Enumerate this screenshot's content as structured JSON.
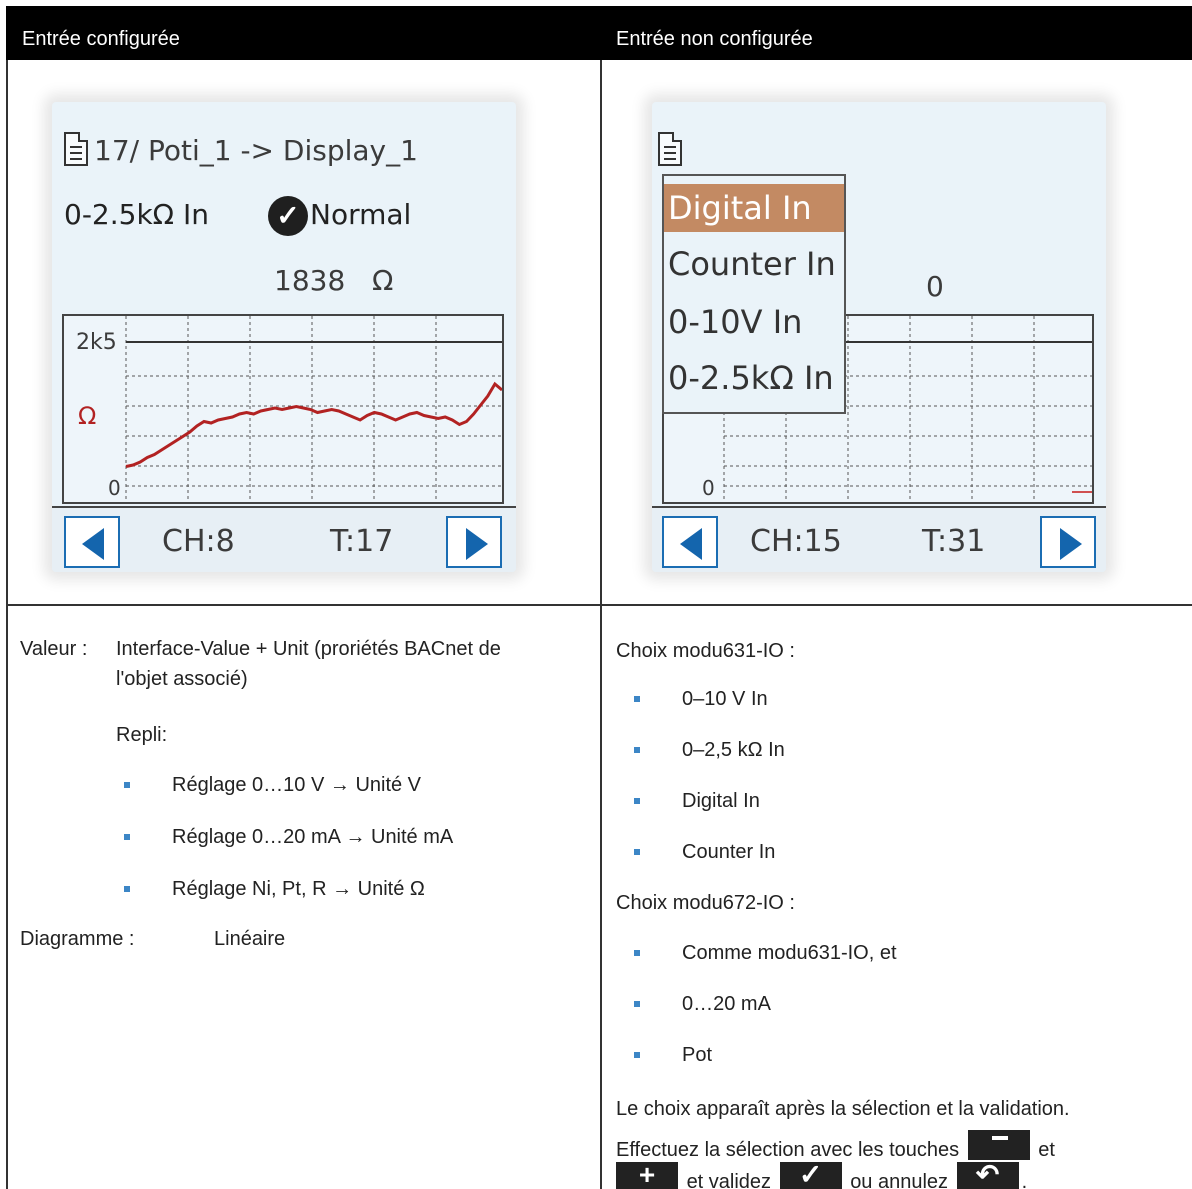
{
  "header": {
    "left": "Entrée configurée",
    "right": "Entrée non configurée"
  },
  "screen1": {
    "title": "17/ Poti_1 -> Display_1",
    "mode": "0-2.5kΩ In",
    "status": "Normal",
    "value": "1838",
    "unit": "Ω",
    "y_top_label": "2k5",
    "y_unit_label": "Ω",
    "y_zero_label": "0",
    "ch": "CH:8",
    "t": "T:17",
    "trace_color": "#b22222",
    "trace": [
      0.17,
      0.18,
      0.2,
      0.23,
      0.25,
      0.28,
      0.31,
      0.34,
      0.37,
      0.4,
      0.44,
      0.47,
      0.46,
      0.48,
      0.49,
      0.5,
      0.52,
      0.53,
      0.52,
      0.54,
      0.55,
      0.56,
      0.55,
      0.56,
      0.57,
      0.56,
      0.55,
      0.53,
      0.54,
      0.55,
      0.54,
      0.52,
      0.5,
      0.48,
      0.51,
      0.53,
      0.52,
      0.5,
      0.48,
      0.5,
      0.52,
      0.53,
      0.51,
      0.5,
      0.49,
      0.5,
      0.48,
      0.45,
      0.47,
      0.52,
      0.58,
      0.64,
      0.72,
      0.68
    ]
  },
  "screen2": {
    "menu": [
      "Digital In",
      "Counter In",
      "0-10V In",
      "0-2.5kΩ In"
    ],
    "value": "0",
    "y_zero_label": "0",
    "ch": "CH:15",
    "t": "T:31",
    "accent": "#c38a63"
  },
  "left_text": {
    "valeur_label": "Valeur :",
    "valeur_line1": "Interface-Value + Unit (proriétés BACnet de",
    "valeur_line2": "l'objet associé)",
    "repli": "Repli:",
    "bullets": [
      "Réglage 0…10 V → Unité V",
      "Réglage 0…20 mA → Unité mA",
      "Réglage Ni, Pt, R → Unité Ω"
    ],
    "diagramme_label": "Diagramme :",
    "diagramme_value": "Linéaire"
  },
  "right_text": {
    "choice1_heading": "Choix modu631-IO :",
    "choice1_items": [
      "0–10 V In",
      "0–2,5 kΩ In",
      "Digital In",
      "Counter In"
    ],
    "choice2_heading": "Choix modu672-IO :",
    "choice2_items": [
      "Comme modu631-IO, et",
      "0…20 mA",
      "Pot"
    ],
    "note_line1": "Le choix apparaît après la sélection et la validation.",
    "note_line2_a": "Effectuez la sélection avec les touches",
    "note_line2_b": "et",
    "note_line3_a": "et validez",
    "note_line3_b": "ou annulez",
    "note_line3_c": ".",
    "key_plus": "+",
    "key_ok": "✓",
    "key_back": "↶"
  },
  "colors": {
    "bullet": "#3c86c6",
    "nav_arrow": "#1465ad"
  }
}
